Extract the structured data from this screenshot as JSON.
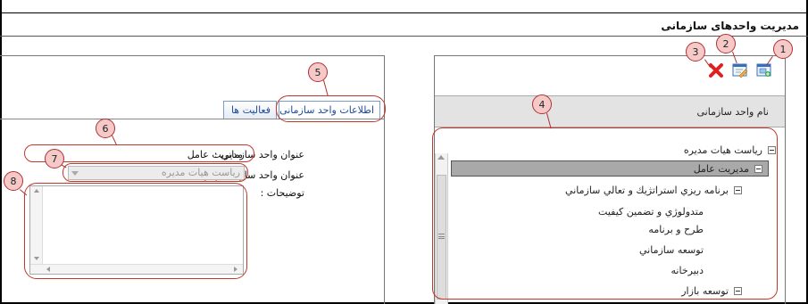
{
  "page": {
    "title": "مدیریت واحدهای سازمانی"
  },
  "toolbar": {
    "buttons": [
      {
        "name": "new",
        "icon": "new-window-icon",
        "callout": "1"
      },
      {
        "name": "edit",
        "icon": "edit-icon",
        "callout": "2"
      },
      {
        "name": "delete",
        "icon": "delete-x-icon",
        "callout": "3"
      }
    ]
  },
  "tree": {
    "column_header": "نام واحد سازمانی",
    "callout": "4",
    "items": [
      {
        "label": "رياست هيات مديره",
        "expandable": true,
        "selected": false
      },
      {
        "label": "مديريت عامل",
        "expandable": true,
        "selected": true
      },
      {
        "label": "برنامه ريزي استراتژيك و تعالي سازماني",
        "expandable": true,
        "selected": false
      },
      {
        "label": "متدولوژي و تضمين كيفيت",
        "expandable": false,
        "selected": false
      },
      {
        "label": "طرح و برنامه",
        "expandable": false,
        "selected": false
      },
      {
        "label": "توسعه سازماني",
        "expandable": false,
        "selected": false
      },
      {
        "label": "دبيرخانه",
        "expandable": false,
        "selected": false
      },
      {
        "label": "توسعه بازار",
        "expandable": true,
        "selected": false
      }
    ]
  },
  "tabs": {
    "callout": "5",
    "items": [
      {
        "label": "اطلاعات واحد سازمانی",
        "active": true
      },
      {
        "label": "فعالیت ها",
        "active": false
      }
    ]
  },
  "form": {
    "unit_title": {
      "label": "عنوان واحد سازمانی :",
      "value": "مدیریت عامل",
      "callout": "6"
    },
    "parent_unit": {
      "label": "عنوان واحد سازمانی پدر :",
      "value": "رياست هيات مديره",
      "callout": "7"
    },
    "description": {
      "label": "توضیحات :",
      "value": "",
      "callout": "8"
    }
  },
  "colors": {
    "annotation_red": "#c0392b",
    "callout_fill": "#f6c9c9",
    "tab_blue": "#1a4a9a",
    "selected_row": "#a9a9a9",
    "header_gray": "#e3e3e3"
  }
}
